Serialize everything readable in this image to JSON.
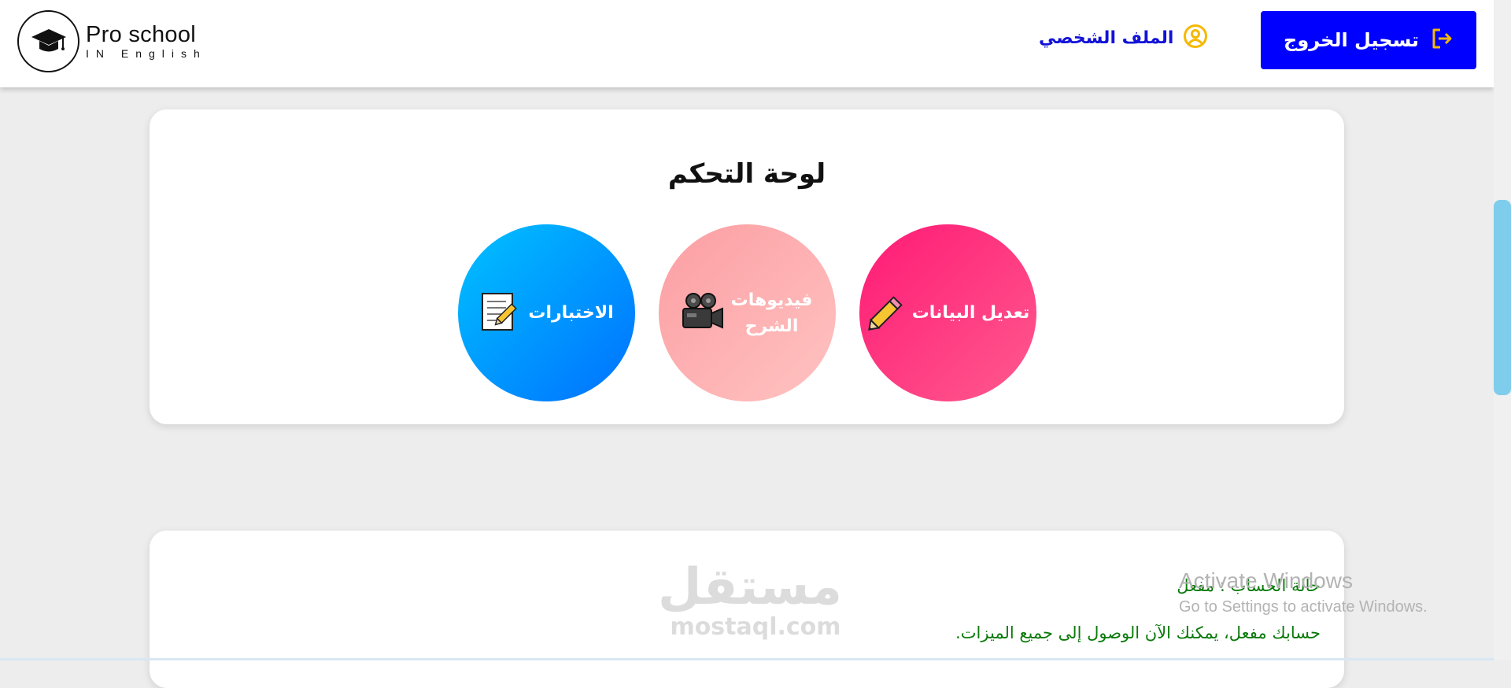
{
  "header": {
    "logo_title": "Pro school",
    "logo_subtitle": "IN English",
    "profile_label": "الملف الشخصي",
    "logout_label": "تسجيل الخروج"
  },
  "dashboard": {
    "title": "لوحة التحكم",
    "tiles": [
      {
        "label": "تعديل البيانات",
        "icon": "pencil-icon",
        "color": "#ff1a75"
      },
      {
        "label": "فيديوهات الشرح",
        "icon": "movie-camera-icon",
        "color": "#fca5a8"
      },
      {
        "label": "الاختبارات",
        "icon": "memo-icon",
        "color": "#0090ff"
      }
    ]
  },
  "account_status": {
    "title": "حالة الحساب : مفعل",
    "message": "حسابك مفعل، يمكنك الآن الوصول إلى جميع الميزات."
  },
  "watermark": {
    "arabic": "مستقل",
    "english": "mostaql.com"
  },
  "windows_activation": {
    "title": "Activate Windows",
    "subtitle": "Go to Settings to activate Windows."
  },
  "colors": {
    "logout_button": "#0000ff",
    "profile_link": "#1212d8",
    "profile_icon": "#f5b800",
    "status_text": "#0a7a0a",
    "page_background": "#ededed"
  }
}
